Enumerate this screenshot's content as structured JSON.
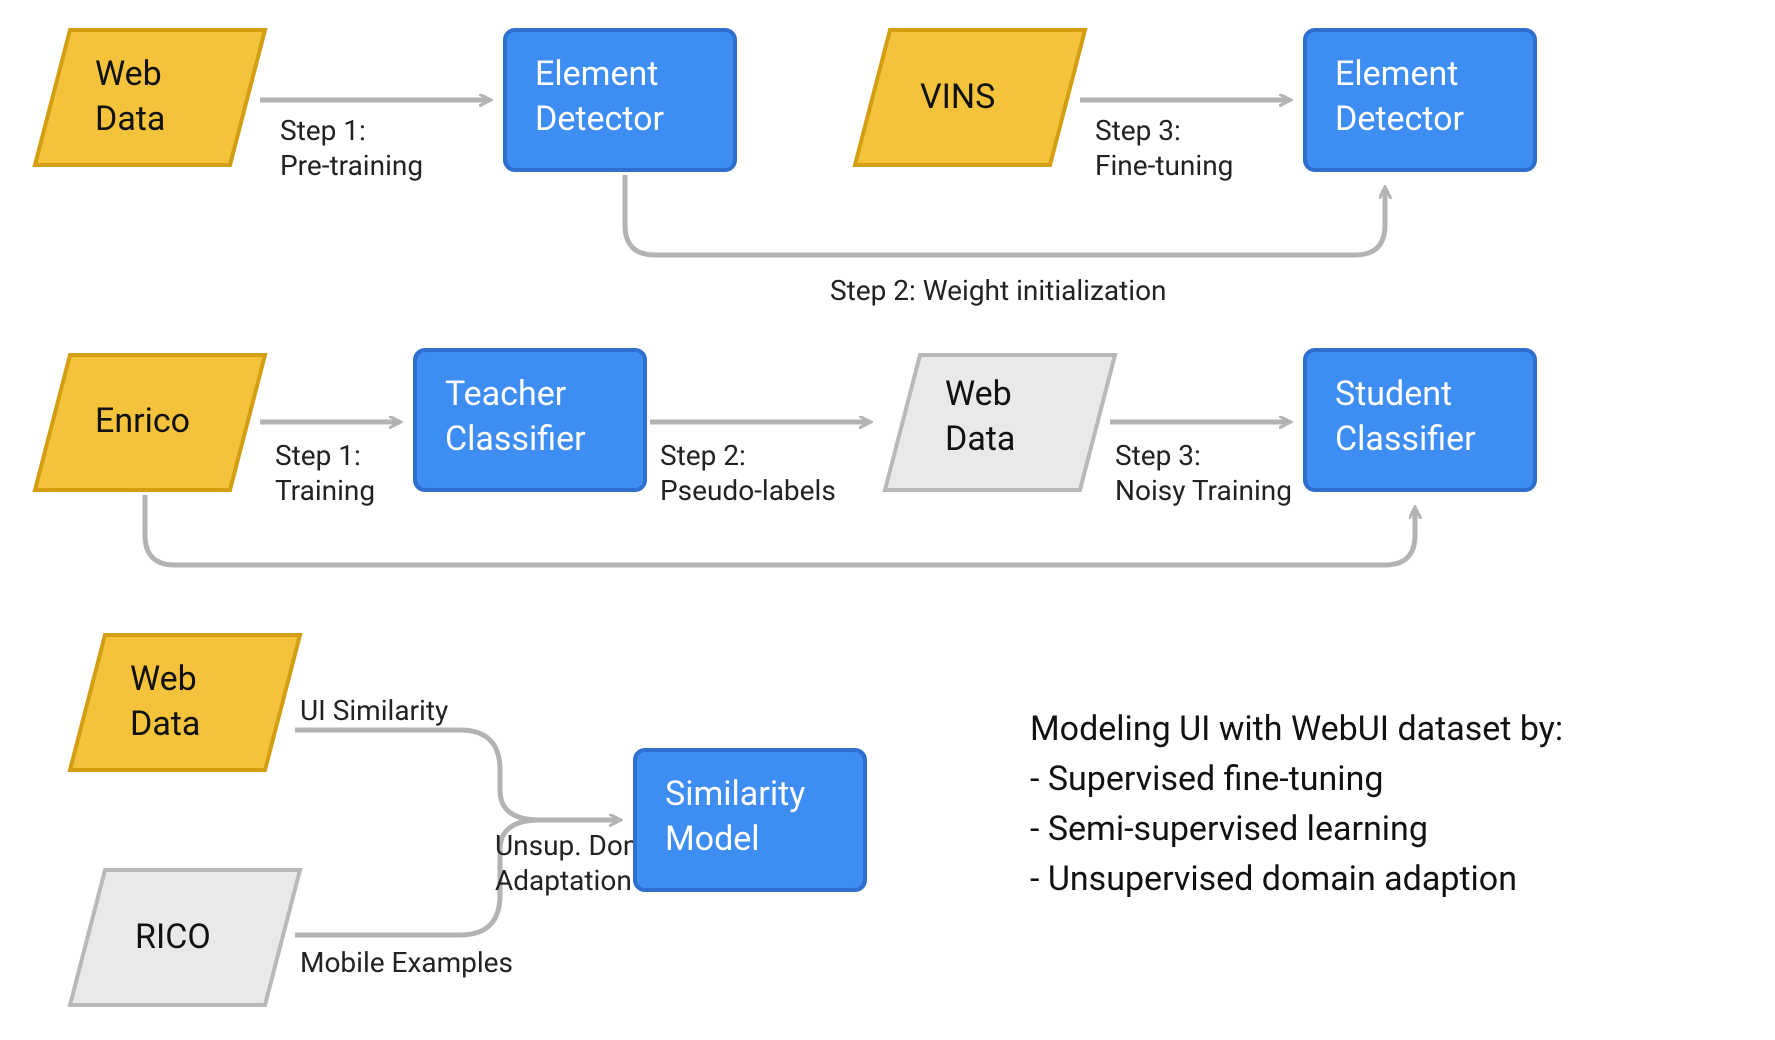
{
  "colors": {
    "yellow_fill": "#F5C33B",
    "yellow_stroke": "#D39E12",
    "blue_fill": "#3E8DF3",
    "blue_stroke": "#2F6FCF",
    "grey_fill": "#E9E9E9",
    "grey_stroke": "#B8B8B8",
    "arrow": "#B3B3B3"
  },
  "row1": {
    "webdata_l1": "Web",
    "webdata_l2": "Data",
    "detector1_l1": "Element",
    "detector1_l2": "Detector",
    "vins": "VINS",
    "detector2_l1": "Element",
    "detector2_l2": "Detector",
    "edge1_l1": "Step 1:",
    "edge1_l2": "Pre-training",
    "edge3_l1": "Step 3:",
    "edge3_l2": "Fine-tuning",
    "edge2": "Step 2: Weight initialization"
  },
  "row2": {
    "enrico": "Enrico",
    "teacher_l1": "Teacher",
    "teacher_l2": "Classifier",
    "webdata_l1": "Web",
    "webdata_l2": "Data",
    "student_l1": "Student",
    "student_l2": "Classifier",
    "edge1_l1": "Step 1:",
    "edge1_l2": "Training",
    "edge2_l1": "Step 2:",
    "edge2_l2": "Pseudo-labels",
    "edge3_l1": "Step 3:",
    "edge3_l2": "Noisy Training"
  },
  "row3": {
    "webdata_l1": "Web",
    "webdata_l2": "Data",
    "rico": "RICO",
    "sim_l1": "Similarity",
    "sim_l2": "Model",
    "edge_top": "UI Similarity",
    "edge_mid_l1": "Unsup. Domain",
    "edge_mid_l2": "Adaptation",
    "edge_bot": "Mobile Examples"
  },
  "legend": {
    "title": "Modeling UI with WebUI dataset by:",
    "items": [
      "- Supervised fine-tuning",
      "- Semi-supervised learning",
      "- Unsupervised domain adaption"
    ]
  }
}
